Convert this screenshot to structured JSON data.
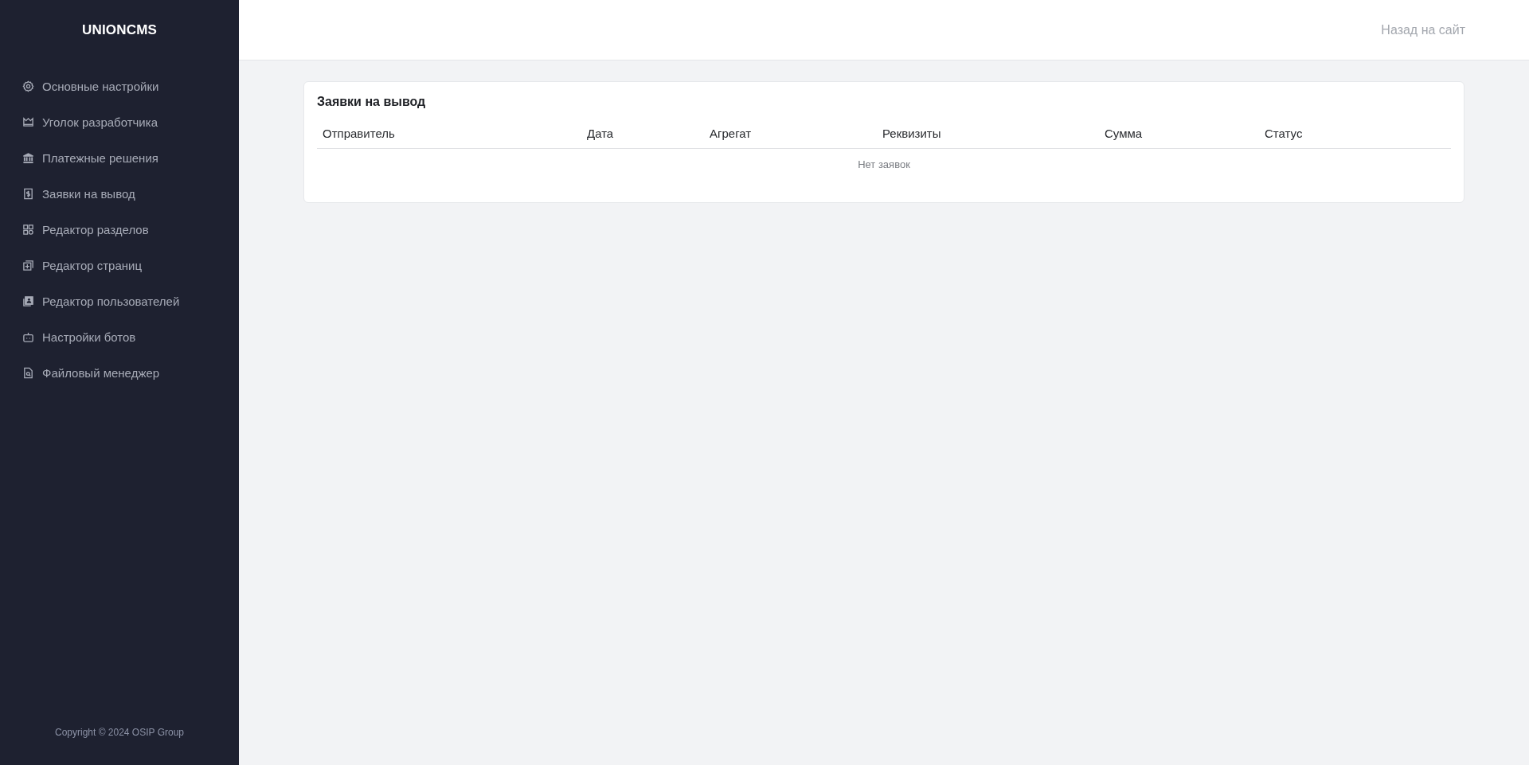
{
  "sidebar": {
    "logo": "UNIONCMS",
    "items": [
      {
        "label": "Основные настройки",
        "kind": "gear"
      },
      {
        "label": "Уголок разработчика",
        "kind": "crown"
      },
      {
        "label": "Платежные решения",
        "kind": "bank"
      },
      {
        "label": "Заявки на вывод",
        "kind": "receipt"
      },
      {
        "label": "Редактор разделов",
        "kind": "grid"
      },
      {
        "label": "Редактор страниц",
        "kind": "pages"
      },
      {
        "label": "Редактор пользователей",
        "kind": "users"
      },
      {
        "label": "Настройки ботов",
        "kind": "robot"
      },
      {
        "label": "Файловый менеджер",
        "kind": "file"
      }
    ],
    "copyright": "Copyright © 2024 OSIP Group"
  },
  "header": {
    "back_link": "Назад на сайт"
  },
  "card": {
    "title": "Заявки на вывод",
    "table": {
      "columns": [
        "Отправитель",
        "Дата",
        "Агрегат",
        "Реквизиты",
        "Сумма",
        "Статус"
      ],
      "empty_message": "Нет заявок"
    }
  }
}
